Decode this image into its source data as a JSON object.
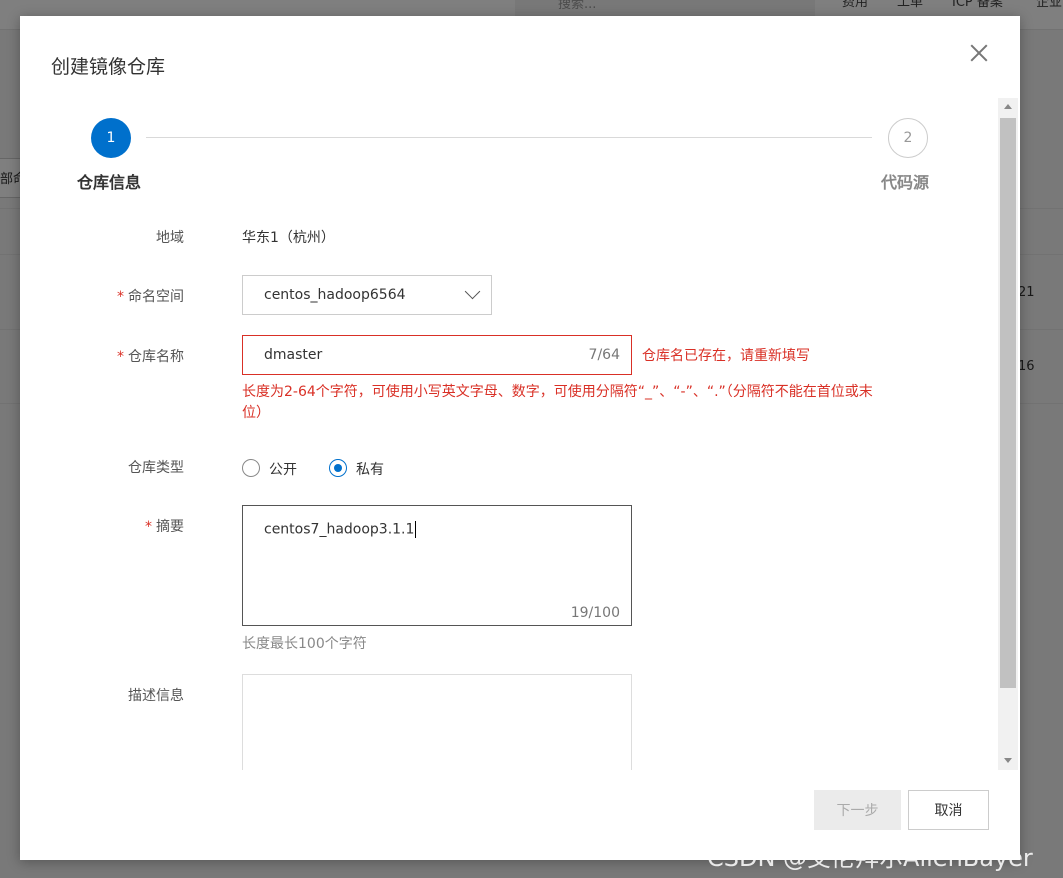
{
  "background": {
    "search_placeholder": "搜索...",
    "nav": [
      "费用",
      "工单",
      "ICP 备案",
      "企业"
    ],
    "side_fragment": "部命",
    "row_numbers": [
      "21",
      "16"
    ]
  },
  "dialog": {
    "title": "创建镜像仓库",
    "steps": [
      {
        "number": "1",
        "label": "仓库信息"
      },
      {
        "number": "2",
        "label": "代码源"
      }
    ],
    "form": {
      "region": {
        "label": "地域",
        "value": "华东1（杭州）"
      },
      "namespace": {
        "label": "命名空间",
        "value": "centos_hadoop6564"
      },
      "repo_name": {
        "label": "仓库名称",
        "value": "dmaster",
        "count": "7/64",
        "error": "仓库名已存在，请重新填写",
        "rule": "长度为2-64个字符，可使用小写英文字母、数字，可使用分隔符“_”、“-”、“.”（分隔符不能在首位或末位）"
      },
      "repo_type": {
        "label": "仓库类型",
        "options": [
          "公开",
          "私有"
        ],
        "selected": "私有"
      },
      "summary": {
        "label": "摘要",
        "value": "centos7_hadoop3.1.1",
        "count": "19/100",
        "help": "长度最长100个字符"
      },
      "description": {
        "label": "描述信息",
        "value": ""
      }
    },
    "buttons": {
      "next": "下一步",
      "cancel": "取消"
    }
  },
  "watermark": "CSDN @艾伦拜尔AllenBayer",
  "colors": {
    "accent": "#0070cc",
    "error": "#d93026"
  }
}
